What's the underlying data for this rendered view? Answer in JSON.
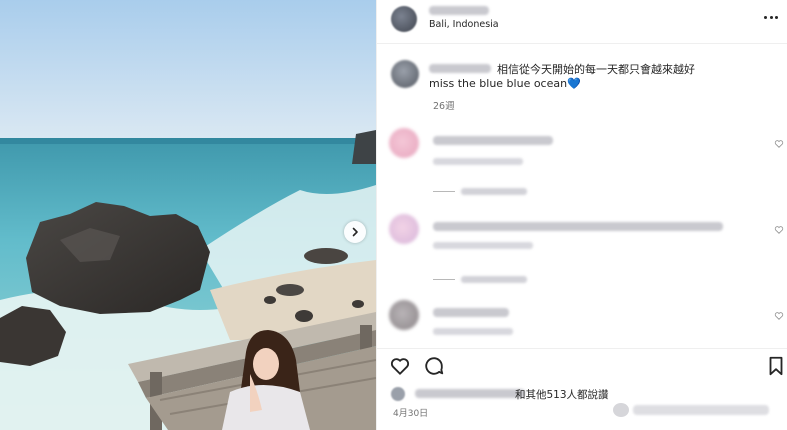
{
  "header": {
    "location": "Bali, Indonesia"
  },
  "caption": {
    "line1": "相信從今天開始的每一天都只會越來越好",
    "line2": "miss the blue blue ocean💙",
    "time": "26週"
  },
  "likes": {
    "text": "和其他513人都說讚"
  },
  "post": {
    "date": "4月30日"
  },
  "icons": {
    "more": "more-icon",
    "next": "chevron-right-icon",
    "like": "heart-icon",
    "comment": "comment-icon",
    "save": "bookmark-icon"
  },
  "colors": {
    "text": "#262626",
    "secondary": "#737373",
    "divider": "#efefef",
    "sea": "#6cc4cf",
    "sky": "#c7def0"
  }
}
